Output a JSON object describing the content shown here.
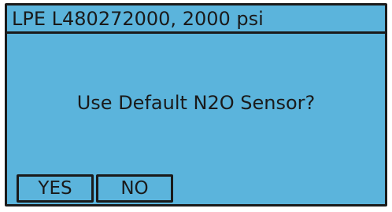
{
  "screen": {
    "title": "LPE L480272000, 2000 psi",
    "prompt": "Use Default N2O Sensor?",
    "buttons": {
      "yes_label": "YES",
      "no_label": "NO"
    }
  },
  "colors": {
    "background": "#5bb4dc",
    "foreground": "#1a1a1a"
  }
}
